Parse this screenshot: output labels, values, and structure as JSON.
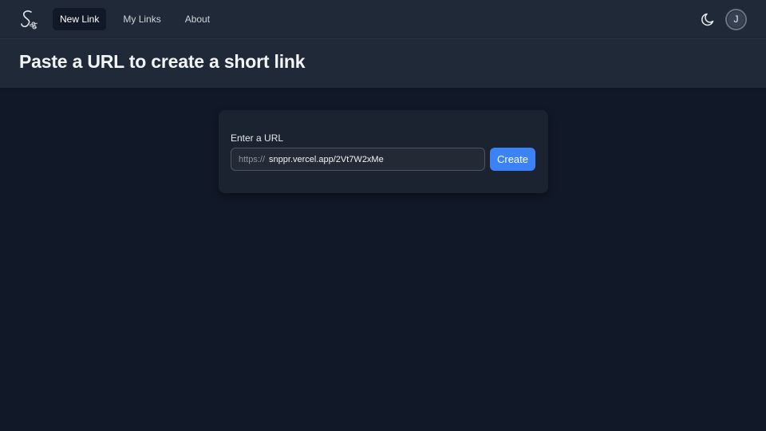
{
  "nav": {
    "logo_icon": "scissors-s-logo-icon",
    "links": [
      {
        "label": "New Link",
        "active": true
      },
      {
        "label": "My Links",
        "active": false
      },
      {
        "label": "About",
        "active": false
      }
    ],
    "theme_icon": "moon-icon",
    "avatar_initial": "J"
  },
  "header": {
    "title": "Paste a URL to create a short link"
  },
  "form": {
    "label": "Enter a URL",
    "prefix": "https://",
    "value": "snppr.vercel.app/2Vt7W2xMe",
    "button_label": "Create"
  },
  "colors": {
    "background": "#111827",
    "navbar": "#1f2937",
    "accent": "#3b82f6"
  }
}
